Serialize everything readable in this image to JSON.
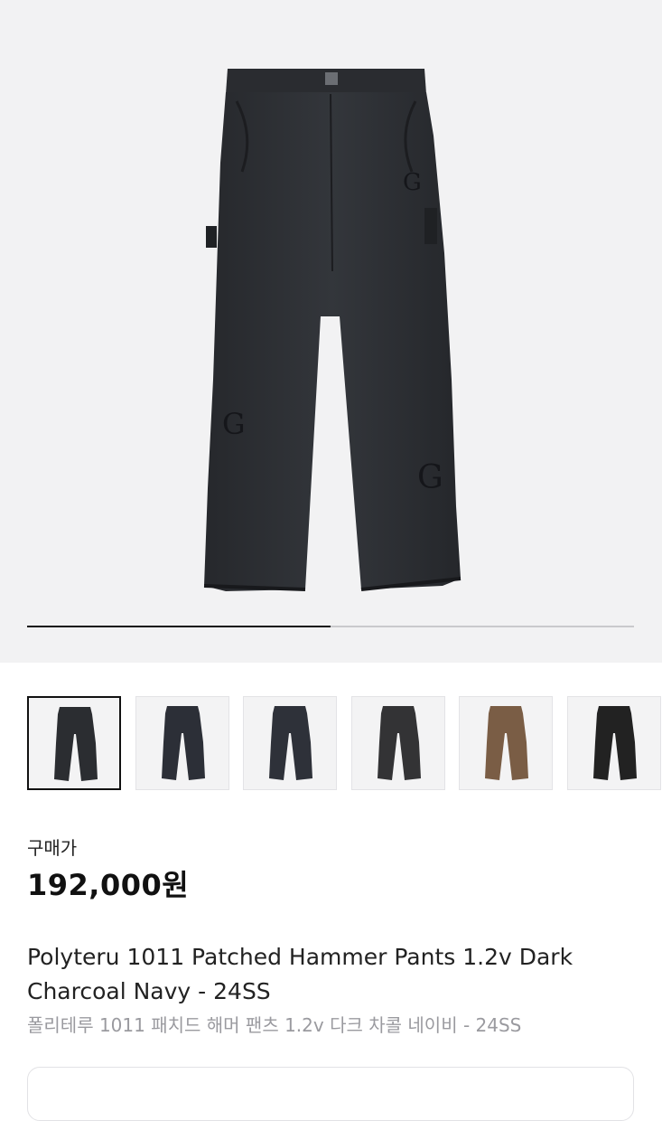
{
  "hero": {
    "image_icon": "pants-product-photo-icon",
    "progress_fraction": 0.5,
    "pants_color": "#2b2d31"
  },
  "thumbnails": [
    {
      "icon": "pants-thumbnail-icon",
      "color": "#2b2d31",
      "selected": true
    },
    {
      "icon": "pants-thumbnail-icon",
      "color": "#2c2f37",
      "selected": false
    },
    {
      "icon": "pants-thumbnail-icon",
      "color": "#2e3139",
      "selected": false
    },
    {
      "icon": "pants-thumbnail-icon",
      "color": "#333335",
      "selected": false
    },
    {
      "icon": "pants-thumbnail-icon",
      "color": "#7a5d45",
      "selected": false
    },
    {
      "icon": "pants-thumbnail-icon",
      "color": "#222222",
      "selected": false
    }
  ],
  "product": {
    "price_label": "구매가",
    "price": "192,000원",
    "title": "Polyteru 1011 Patched Hammer Pants 1.2v Dark Charcoal Navy - 24SS",
    "subtitle": "폴리테루 1011 패치드 해머 팬츠 1.2v 다크 차콜 네이비 - 24SS"
  }
}
